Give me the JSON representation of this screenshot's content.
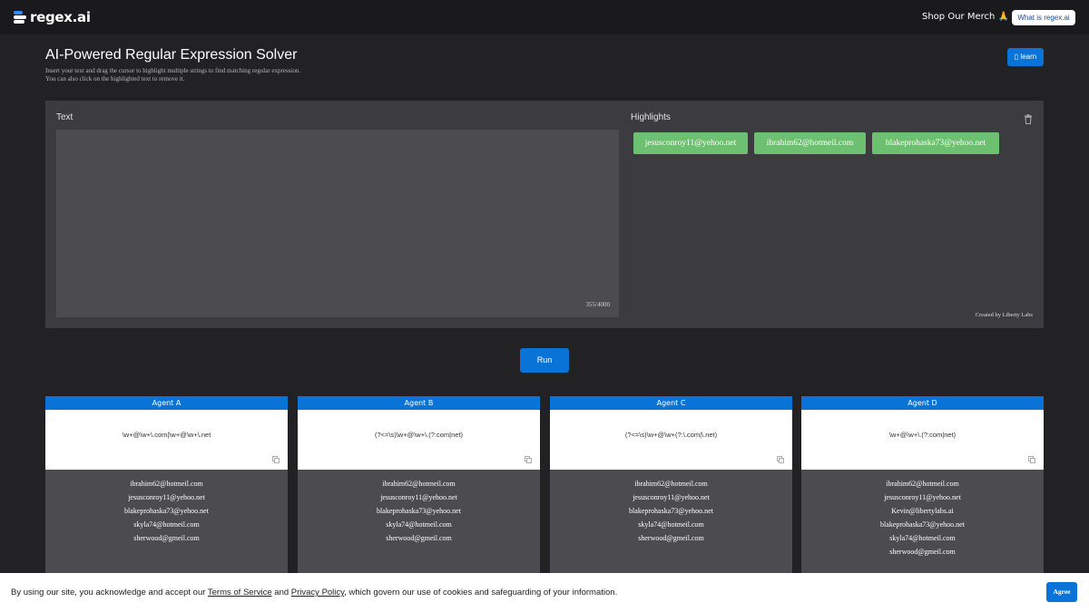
{
  "header": {
    "logo_text": "regex.ai",
    "merch_label": "Shop Our Merch 🙏",
    "whatis_label": "What is regex.ai"
  },
  "page": {
    "title": "AI-Powered Regular Expression Solver",
    "subtitle_line1": "Insert your text and drag the cursor to highlight multiple strings to find matching regular expression.",
    "subtitle_line2": "You can also click on the highlighted text to remove it.",
    "learn_label": "learn"
  },
  "panel": {
    "text_label": "Text",
    "char_counter": "355/4000",
    "highlights_label": "Highlights",
    "highlights": [
      "jesusconroy11@yehoo.net",
      "ibrahim62@hotmeil.com",
      "blakeprohaska73@yehoo.net"
    ],
    "credit": "Created by Liberty Labs"
  },
  "run_label": "Run",
  "agents": [
    {
      "name": "Agent A",
      "regex": "\\w+@\\w+\\.com|\\w+@\\w+\\.net",
      "results": [
        "ibrahim62@hotmeil.com",
        "jesusconroy11@yehoo.net",
        "blakeprohaska73@yehoo.net",
        "skyla74@hotmeil.com",
        "sherwood@gmeil.com"
      ]
    },
    {
      "name": "Agent B",
      "regex": "(?<=\\s)\\w+@\\w+\\.(?:com|net)",
      "results": [
        "ibrahim62@hotmeil.com",
        "jesusconroy11@yehoo.net",
        "blakeprohaska73@yehoo.net",
        "skyla74@hotmeil.com",
        "sherwood@gmeil.com"
      ]
    },
    {
      "name": "Agent C",
      "regex": "(?<=\\s)\\w+@\\w+(?:\\.com|\\.net)",
      "results": [
        "ibrahim62@hotmeil.com",
        "jesusconroy11@yehoo.net",
        "blakeprohaska73@yehoo.net",
        "skyla74@hotmeil.com",
        "sherwood@gmeil.com"
      ]
    },
    {
      "name": "Agent D",
      "regex": "\\w+@\\w+\\.(?:com|net)",
      "results": [
        "ibrahim62@hotmeil.com",
        "jesusconroy11@yehoo.net",
        "Kevin@libertylabs.ai",
        "blakeprohaska73@yehoo.net",
        "skyla74@hotmeil.com",
        "sherwood@gmeil.com"
      ]
    }
  ],
  "cookie": {
    "text_before": "By using our site, you acknowledge and accept our ",
    "tos_link": "Terms of Service",
    "text_and": " and ",
    "privacy_link": "Privacy Policy",
    "text_after": ", which govern our use of cookies and safeguarding of your information.",
    "agree_label": "Agree"
  },
  "colors": {
    "accent": "#0a73d8",
    "highlight_chip": "#6cc06f",
    "background": "#222225",
    "panel": "#3c3c40"
  }
}
